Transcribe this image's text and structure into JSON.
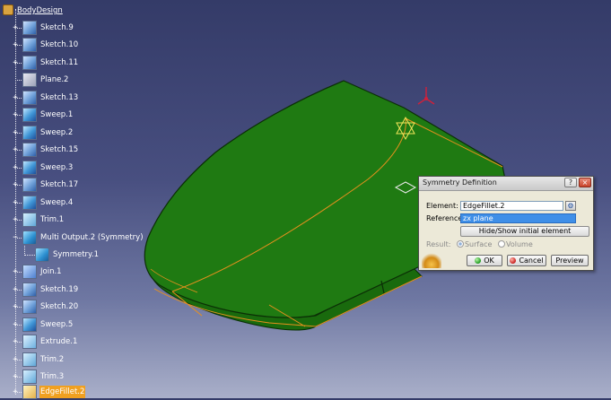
{
  "tree": {
    "root_label": "BodyDesign",
    "items": [
      {
        "label": "Sketch.9",
        "icon": "sketch-icon"
      },
      {
        "label": "Sketch.10",
        "icon": "sketch-icon"
      },
      {
        "label": "Sketch.11",
        "icon": "sketch-icon"
      },
      {
        "label": "Plane.2",
        "icon": "plane-icon"
      },
      {
        "label": "Sketch.13",
        "icon": "sketch-icon"
      },
      {
        "label": "Sweep.1",
        "icon": "sweep-icon"
      },
      {
        "label": "Sweep.2",
        "icon": "sweep-icon"
      },
      {
        "label": "Sketch.15",
        "icon": "sketch-icon"
      },
      {
        "label": "Sweep.3",
        "icon": "sweep-icon"
      },
      {
        "label": "Sketch.17",
        "icon": "sketch-icon"
      },
      {
        "label": "Sweep.4",
        "icon": "sweep-icon"
      },
      {
        "label": "Trim.1",
        "icon": "trim-icon"
      },
      {
        "label": "Multi Output.2 (Symmetry)",
        "icon": "multi-output-icon"
      },
      {
        "label": "Symmetry.1",
        "icon": "symmetry-icon"
      },
      {
        "label": "Join.1",
        "icon": "join-icon"
      },
      {
        "label": "Sketch.19",
        "icon": "sketch-icon"
      },
      {
        "label": "Sketch.20",
        "icon": "sketch-icon"
      },
      {
        "label": "Sweep.5",
        "icon": "sweep-icon"
      },
      {
        "label": "Extrude.1",
        "icon": "extrude-icon"
      },
      {
        "label": "Trim.2",
        "icon": "trim-icon"
      },
      {
        "label": "Trim.3",
        "icon": "trim-icon"
      },
      {
        "label": "EdgeFillet.2",
        "icon": "edge-fillet-icon"
      }
    ]
  },
  "dialog": {
    "title": "Symmetry Definition",
    "help_glyph": "?",
    "close_glyph": "×",
    "element_label": "Element:",
    "element_value": "EdgeFillet.2",
    "reference_label": "Reference:",
    "reference_value": "zx plane",
    "hide_show_label": "Hide/Show initial element",
    "result_label": "Result:",
    "result_options": [
      "Surface",
      "Volume"
    ],
    "ok_label": "OK",
    "cancel_label": "Cancel",
    "preview_label": "Preview"
  },
  "colors": {
    "surface": "#1f7a12",
    "edge": "#e8901e",
    "selection": "#f0a020"
  }
}
